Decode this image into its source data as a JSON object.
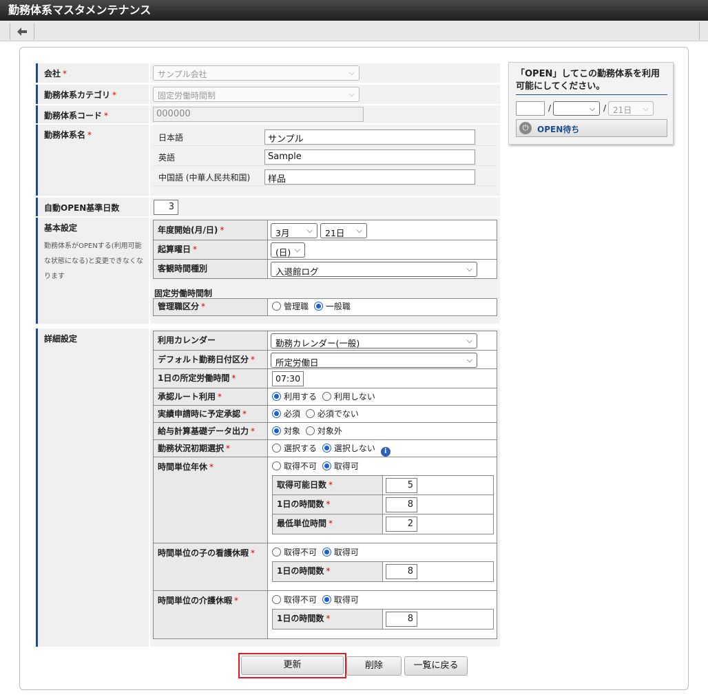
{
  "window": {
    "title": "勤務体系マスタメンテナンス"
  },
  "form": {
    "company": {
      "label": "会社",
      "value": "サンプル会社"
    },
    "category": {
      "label": "勤務体系カテゴリ",
      "value": "固定労働時間制"
    },
    "code": {
      "label": "勤務体系コード",
      "value": "000000"
    },
    "name": {
      "label": "勤務体系名",
      "langs": [
        {
          "lang": "日本語",
          "value": "サンプル"
        },
        {
          "lang": "英語",
          "value": "Sample"
        },
        {
          "lang": "中国語 (中華人民共和国)",
          "value": "样品"
        }
      ]
    },
    "auto_open": {
      "label": "自動OPEN基準日数",
      "value": "3"
    },
    "basic": {
      "label": "基本設定",
      "note": "勤務体系がOPENする(利用可能な状態になる)と変更できなくなります",
      "year_start_label": "年度開始(月/日)",
      "year_start_month": "3月",
      "year_start_day": "21日",
      "start_weekday_label": "起算曜日",
      "start_weekday": "(日)",
      "objective_time_label": "客観時間種別",
      "objective_time": "入退館ログ",
      "fixed_heading": "固定労働時間制",
      "manager_label": "管理職区分",
      "manager_opt1": "管理職",
      "manager_opt2": "一般職"
    },
    "detail": {
      "label": "詳細設定",
      "calendar_label": "利用カレンダー",
      "calendar": "勤務カレンダー(一般)",
      "default_day_label": "デフォルト勤務日付区分",
      "default_day": "所定労働日",
      "daily_hours_label": "1日の所定労働時間",
      "daily_hours": "07:30",
      "approval_route_label": "承認ルート利用",
      "approval_route_opt1": "利用する",
      "approval_route_opt2": "利用しない",
      "plan_approval_label": "実績申請時に予定承認",
      "plan_approval_opt1": "必須",
      "plan_approval_opt2": "必須でない",
      "payroll_label": "給与計算基礎データ出力",
      "payroll_opt1": "対象",
      "payroll_opt2": "対象外",
      "initial_select_label": "勤務状況初期選択",
      "initial_select_opt1": "選択する",
      "initial_select_opt2": "選択しない",
      "hourly_leave_label": "時間単位年休",
      "opt_no": "取得不可",
      "opt_yes": "取得可",
      "days_label": "取得可能日数",
      "days": "5",
      "hours_per_day_label": "1日の時間数",
      "hours_per_day": "8",
      "min_unit_label": "最低単位時間",
      "min_unit": "2",
      "child_care_label": "時間単位の子の看護休暇",
      "child_care_hours": "8",
      "nursing_care_label": "時間単位の介護休暇",
      "nursing_care_hours": "8"
    }
  },
  "buttons": {
    "update": "更新",
    "delete": "削除",
    "back": "一覧に戻る"
  },
  "open_panel": {
    "message": "「OPEN」してこの勤務体系を利用可能にしてください。",
    "date_sep": "/",
    "day": "21日",
    "status": "OPEN待ち"
  },
  "required_mark": "*"
}
